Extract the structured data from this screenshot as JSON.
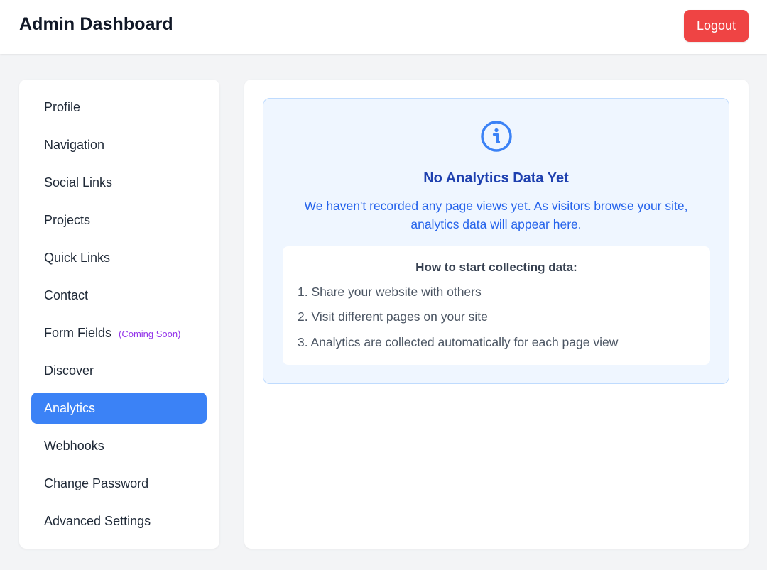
{
  "header": {
    "title": "Admin Dashboard",
    "logout_label": "Logout"
  },
  "sidebar": {
    "items": [
      {
        "label": "Profile"
      },
      {
        "label": "Navigation"
      },
      {
        "label": "Social Links"
      },
      {
        "label": "Projects"
      },
      {
        "label": "Quick Links"
      },
      {
        "label": "Contact"
      },
      {
        "label": "Form Fields",
        "badge": "(Coming Soon)"
      },
      {
        "label": "Discover"
      },
      {
        "label": "Analytics",
        "active": true
      },
      {
        "label": "Webhooks"
      },
      {
        "label": "Change Password"
      },
      {
        "label": "Advanced Settings"
      }
    ]
  },
  "analytics": {
    "icon": "info-icon",
    "title": "No Analytics Data Yet",
    "message": "We haven't recorded any page views yet. As visitors browse your site, analytics data will appear here.",
    "steps_title": "How to start collecting data:",
    "steps": [
      "1. Share your website with others",
      "2. Visit different pages on your site",
      "3. Analytics are collected automatically for each page view"
    ]
  },
  "colors": {
    "accent": "#3b82f6",
    "logout": "#ef4444",
    "info_title": "#1e40af",
    "info_text": "#2563eb",
    "badge": "#9333ea"
  }
}
